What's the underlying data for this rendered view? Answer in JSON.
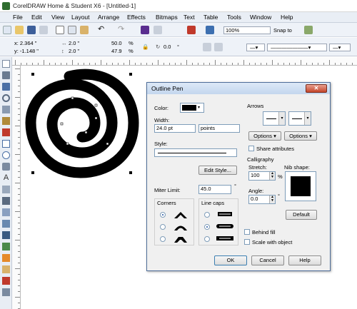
{
  "window": {
    "title": "CorelDRAW Home & Student X6 - [Untitled-1]"
  },
  "menu": [
    "File",
    "Edit",
    "View",
    "Layout",
    "Arrange",
    "Effects",
    "Bitmaps",
    "Text",
    "Table",
    "Tools",
    "Window",
    "Help"
  ],
  "toolbar": {
    "zoom": "100%",
    "snap_to": "Snap to"
  },
  "property_bar": {
    "x": "x: 2.364 \"",
    "y": "y: -1.148 \"",
    "w": "2.0 \"",
    "h": "2.0 \"",
    "scale_w": "50.0",
    "scale_h": "47.9",
    "pct1": "%",
    "pct2": "%",
    "angle": "0.0",
    "deg": "°"
  },
  "dialog": {
    "title": "Outline Pen",
    "close": "✕",
    "color_label": "Color:",
    "width_label": "Width:",
    "width_value": "24.0 pt",
    "width_unit": "points",
    "style_label": "Style:",
    "edit_style": "Edit Style...",
    "miter_label": "Miter Limit:",
    "miter_value": "45.0",
    "deg": "°",
    "corners_label": "Corners",
    "linecaps_label": "Line caps",
    "arrows_label": "Arrows",
    "options1": "Options",
    "options2": "Options",
    "share_attributes": "Share attributes",
    "calligraphy_label": "Calligraphy",
    "stretch_label": "Stretch:",
    "stretch_value": "100",
    "pct": "%",
    "nib_label": "Nib shape:",
    "angle_label": "Angle:",
    "angle_value": "0.0",
    "default_button": "Default",
    "behind_fill": "Behind fill",
    "scale_with_object": "Scale with object",
    "ok": "OK",
    "cancel": "Cancel",
    "help": "Help"
  },
  "colors": {
    "accent": "#1b4ea0",
    "title_bg": "#c3d6ee",
    "close_red": "#c4452a",
    "canvas_shape": "#000000"
  }
}
